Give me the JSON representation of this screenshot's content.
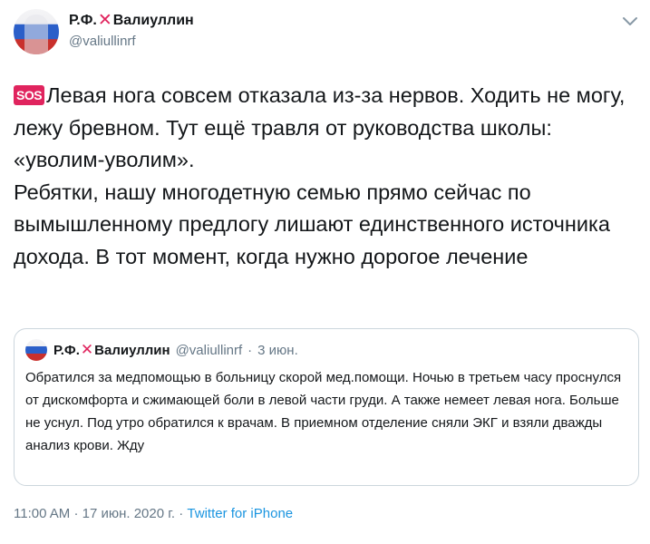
{
  "author": {
    "name_part1": "Р.Ф.",
    "name_part2": "Валиуллин",
    "cross_glyph": "✕",
    "handle": "@valiullinrf"
  },
  "tweet": {
    "sos_badge": "SOS",
    "line1": "Левая нога совсем отказала из-за нервов. Ходить не могу, лежу бревном. Тут ещё травля от руководства школы: «уволим-уволим».",
    "line2": "Ребятки, нашу многодетную семью прямо сейчас по вымышленному предлогу лишают единственного источника дохода. В тот момент, когда нужно дорогое лечение"
  },
  "quoted_tweet": {
    "name_part1": "Р.Ф.",
    "name_part2": "Валиуллин",
    "handle": "@valiullinrf",
    "separator": "·",
    "date": "3 июн.",
    "text": "Обратился за медпомощью в больницу скорой мед.помощи. Ночью в третьем часу проснулся от дискомфорта и сжимающей боли в левой части груди. А также немеет левая нога. Больше не уснул. Под утро обратился к врачам. В приемном отделение сняли ЭКГ и взяли дважды анализ крови. Жду"
  },
  "footer": {
    "time": "11:00 AM",
    "sep1": "·",
    "date": "17 июн. 2020 г.",
    "sep2": "·",
    "source": "Twitter for iPhone"
  },
  "colors": {
    "text": "#14171a",
    "secondary": "#657786",
    "link": "#1b95e0",
    "cross_red": "#e0245e",
    "border": "#ccd6dd"
  },
  "icons": [
    "chevron-down-icon",
    "cross-mark-icon",
    "sos-icon"
  ]
}
